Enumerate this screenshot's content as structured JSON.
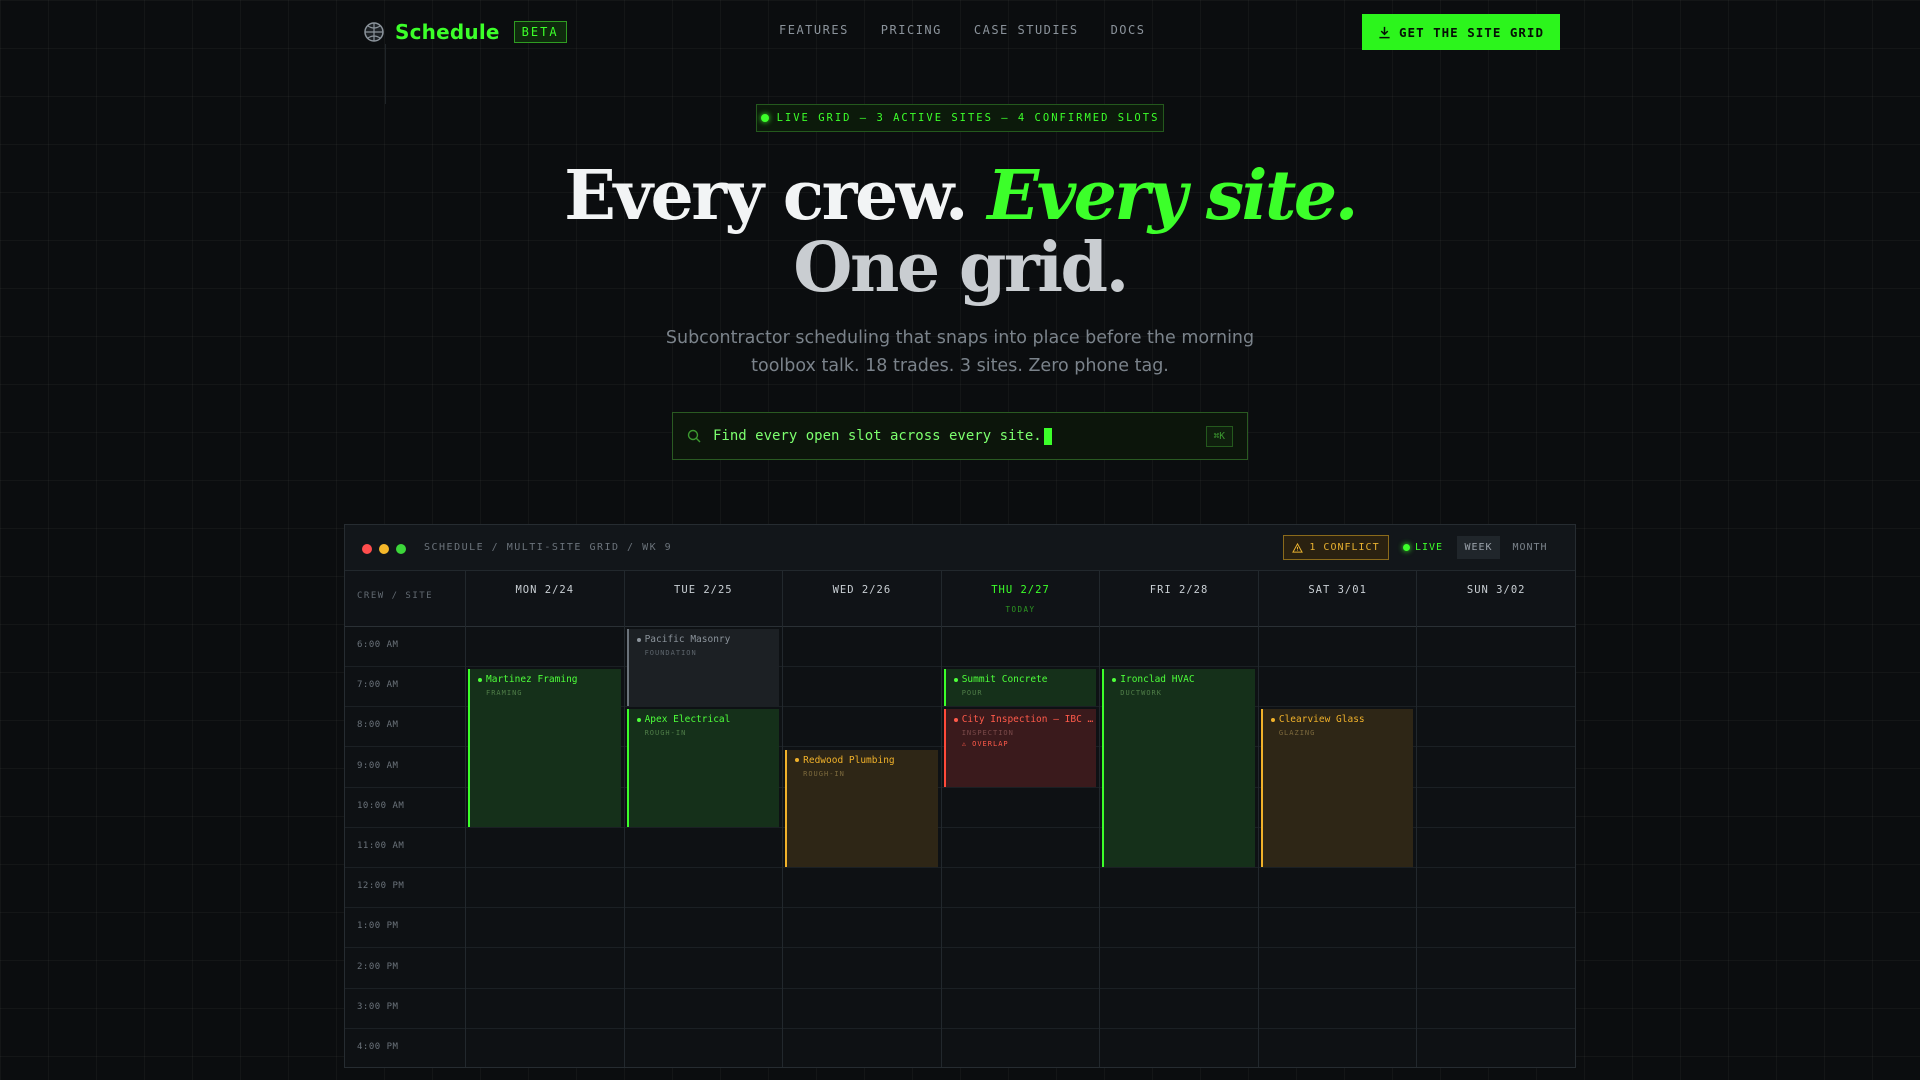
{
  "nav": {
    "brand": "Schedule",
    "badge": "BETA",
    "links": [
      "FEATURES",
      "PRICING",
      "CASE STUDIES",
      "DOCS"
    ],
    "cta": "GET THE SITE GRID"
  },
  "hero": {
    "status": "LIVE GRID — 3 ACTIVE SITES — 4 CONFIRMED SLOTS",
    "headline_a": "Every crew.",
    "headline_b": "Every site.",
    "headline_c": "One grid.",
    "subtitle": "Subcontractor scheduling that snaps into place before the morning toolbox talk. 18 trades. 3 sites. Zero phone tag.",
    "search_value": "Find every open slot across every site.",
    "search_shortcut": "⌘K"
  },
  "app": {
    "breadcrumb": "SCHEDULE / MULTI-SITE GRID / WK 9",
    "conflict": "1 CONFLICT",
    "live": "LIVE",
    "view_week": "WEEK",
    "view_month": "MONTH",
    "corner": "CREW / SITE",
    "today_tag": "TODAY",
    "days": [
      "MON 2/24",
      "TUE 2/25",
      "WED 2/26",
      "THU 2/27",
      "FRI 2/28",
      "SAT 3/01",
      "SUN 3/02"
    ],
    "today_index": 3,
    "times": [
      "6:00 AM",
      "7:00 AM",
      "8:00 AM",
      "9:00 AM",
      "10:00 AM",
      "11:00 AM",
      "12:00 PM",
      "1:00 PM",
      "2:00 PM",
      "3:00 PM",
      "4:00 PM"
    ],
    "events": [
      {
        "title": "Martinez Framing",
        "trade": "FRAMING",
        "day": 0,
        "start": 1,
        "span": 4,
        "tone": "green"
      },
      {
        "title": "Pacific Masonry",
        "trade": "FOUNDATION",
        "day": 1,
        "start": 0,
        "span": 2,
        "tone": "grey"
      },
      {
        "title": "Apex Electrical",
        "trade": "ROUGH-IN",
        "day": 1,
        "start": 2,
        "span": 3,
        "tone": "green"
      },
      {
        "title": "Redwood Plumbing",
        "trade": "ROUGH-IN",
        "day": 2,
        "start": 3,
        "span": 3,
        "tone": "amber"
      },
      {
        "title": "Summit Concrete",
        "trade": "POUR",
        "day": 3,
        "start": 1,
        "span": 1,
        "tone": "green"
      },
      {
        "title": "City Inspection — IBC …",
        "trade": "INSPECTION",
        "warn": "⚠ OVERLAP",
        "day": 3,
        "start": 2,
        "span": 2,
        "tone": "red"
      },
      {
        "title": "Ironclad HVAC",
        "trade": "DUCTWORK",
        "day": 4,
        "start": 1,
        "span": 5,
        "tone": "green"
      },
      {
        "title": "Clearview Glass",
        "trade": "GLAZING",
        "day": 5,
        "start": 2,
        "span": 4,
        "tone": "amber"
      }
    ]
  },
  "colors": {
    "accent": "#3cff2a",
    "amber": "#f0b12a",
    "danger": "#ff4a3a",
    "background": "#0b0d0f"
  }
}
